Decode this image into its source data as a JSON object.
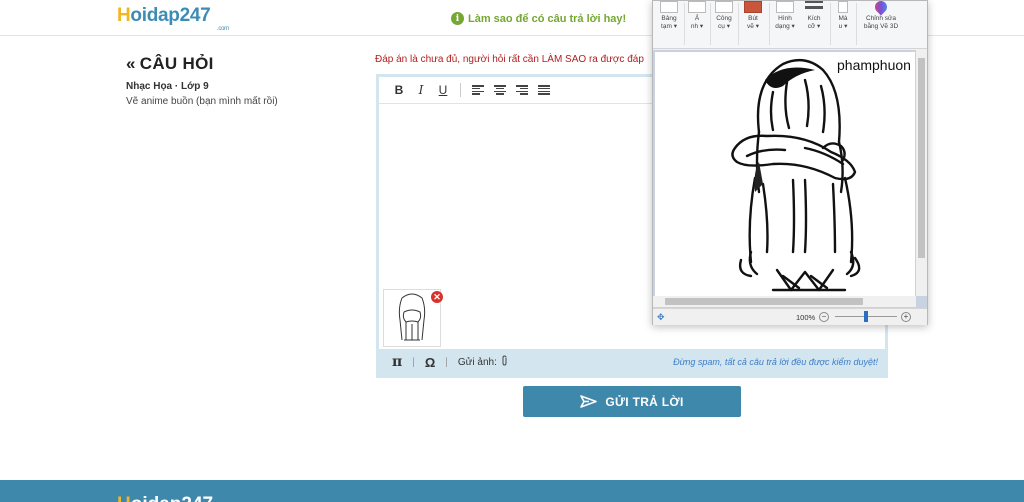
{
  "header": {
    "logo_h": "H",
    "logo_rest": "oidap247",
    "logo_suffix": ".com",
    "tip": "Làm sao để có câu trả lời hay!"
  },
  "question": {
    "title": "CÂU HỎI",
    "subject": "Nhạc Họa · Lớp 9",
    "text": "Vẽ anime buồn (bạn mình mất rồi)"
  },
  "editor": {
    "warning": "Đáp án là chưa đủ, người hỏi rất cần LÀM SAO ra được đáp",
    "toolbar": {
      "bold": "B",
      "italic": "I",
      "underline": "U"
    },
    "footer": {
      "pi": "π",
      "omega": "Ω",
      "send_image": "Gửi ảnh:",
      "spam_notice": "Đừng spam, tất cả câu trả lời đều được kiểm duyệt!"
    }
  },
  "submit_label": "GỬI TRẢ LỜI",
  "footer_logo_h": "H",
  "footer_logo_rest": "oidap247",
  "paint": {
    "ribbon": [
      {
        "line1": "Bảng",
        "line2": "tạm ▾"
      },
      {
        "line1": "Ả",
        "line2": "nh ▾"
      },
      {
        "line1": "Công",
        "line2": "cụ ▾"
      },
      {
        "line1": "Bút",
        "line2": "vẽ ▾"
      },
      {
        "line1": "Hình",
        "line2": "dạng ▾"
      },
      {
        "line1": "Kích",
        "line2": "cỡ ▾"
      },
      {
        "line1": "Mà",
        "line2": "u ▾"
      },
      {
        "line1": "Chỉnh sửa",
        "line2": "bằng Vẽ 3D"
      }
    ],
    "signature": "phamphuon",
    "zoom": "100%"
  },
  "colors": {
    "brand_blue": "#3e88ab",
    "logo_yellow": "#f3b61d",
    "tip_green": "#74a832",
    "warning_red": "#b02020"
  }
}
